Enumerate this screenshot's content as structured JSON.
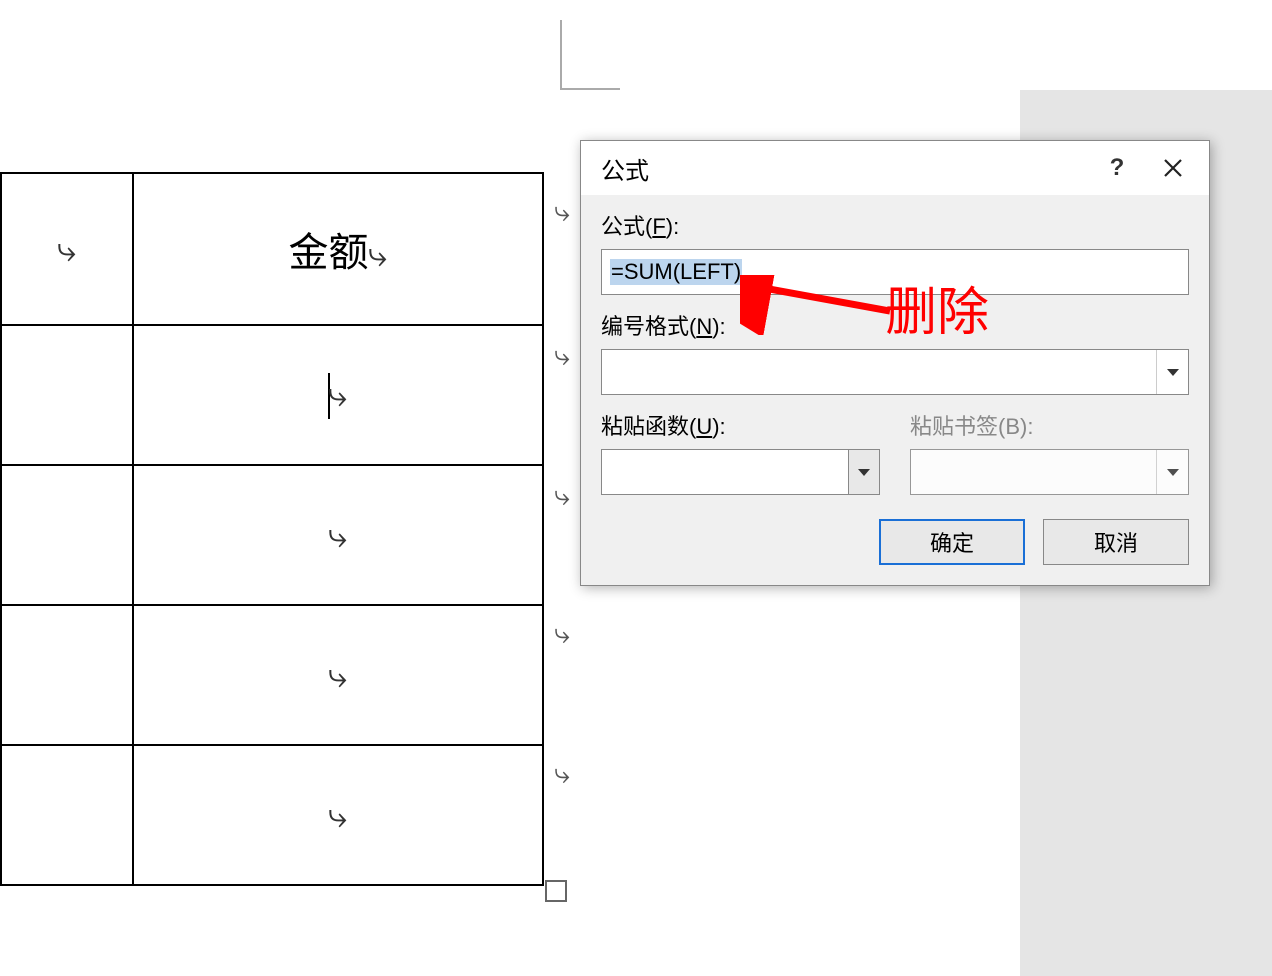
{
  "page": {
    "corner_present": true
  },
  "table": {
    "header": {
      "col1_text": "金额"
    },
    "row_end_mark": "↵"
  },
  "dialog": {
    "title": "公式",
    "help_symbol": "?",
    "formula_label_prefix": "公式(",
    "formula_label_acc": "F",
    "formula_label_suffix": "):",
    "formula_value": "=SUM(LEFT)",
    "number_format_label_prefix": "编号格式(",
    "number_format_label_acc": "N",
    "number_format_label_suffix": "):",
    "number_format_value": "",
    "paste_func_label_prefix": "粘贴函数(",
    "paste_func_label_acc": "U",
    "paste_func_label_suffix": "):",
    "paste_func_value": "",
    "paste_bookmark_label_prefix": "粘贴书签(",
    "paste_bookmark_label_acc": "B",
    "paste_bookmark_label_suffix": "):",
    "paste_bookmark_value": "",
    "ok_label": "确定",
    "cancel_label": "取消"
  },
  "annotation": {
    "text": "删除"
  }
}
